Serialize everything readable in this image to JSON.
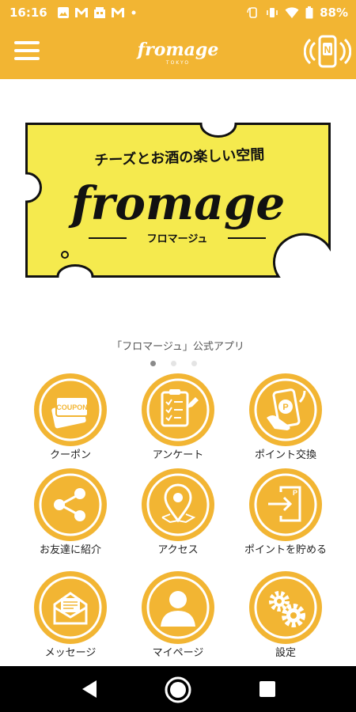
{
  "status_bar": {
    "time": "16:16",
    "battery": "88%",
    "notification_icons": [
      "image-icon",
      "gmail-icon",
      "store-icon",
      "gmail-icon",
      "dot-icon"
    ],
    "status_icons": [
      "rotate-icon",
      "vibrate-icon",
      "wifi-icon",
      "battery-icon"
    ]
  },
  "app_bar": {
    "title": "fromage",
    "subtitle": "TOKYO",
    "menu_icon": "hamburger-menu-icon",
    "nfc_icon": "nfc-phone-icon"
  },
  "banner": {
    "tagline": "チーズとお酒の楽しい空間",
    "logo": "fromage",
    "reading": "フロマージュ",
    "background_color": "#f5ea4e"
  },
  "caption": "「フロマージュ」公式アプリ",
  "carousel": {
    "count": 3,
    "active": 0
  },
  "menu": {
    "items": [
      {
        "label": "クーポン",
        "icon": "coupon-icon"
      },
      {
        "label": "アンケート",
        "icon": "questionnaire-icon"
      },
      {
        "label": "ポイント交換",
        "icon": "point-exchange-icon"
      },
      {
        "label": "お友達に紹介",
        "icon": "share-icon"
      },
      {
        "label": "アクセス",
        "icon": "map-pin-icon"
      },
      {
        "label": "ポイントを貯める",
        "icon": "collect-points-icon"
      },
      {
        "label": "メッセージ",
        "icon": "message-icon"
      },
      {
        "label": "マイページ",
        "icon": "profile-icon"
      },
      {
        "label": "設定",
        "icon": "gears-icon"
      }
    ]
  },
  "colors": {
    "accent": "#f2b533",
    "nav_bar": "#000000"
  },
  "nav_bar": {
    "back_icon": "back-triangle-icon",
    "home_icon": "home-circle-icon",
    "recent_icon": "recent-square-icon"
  }
}
